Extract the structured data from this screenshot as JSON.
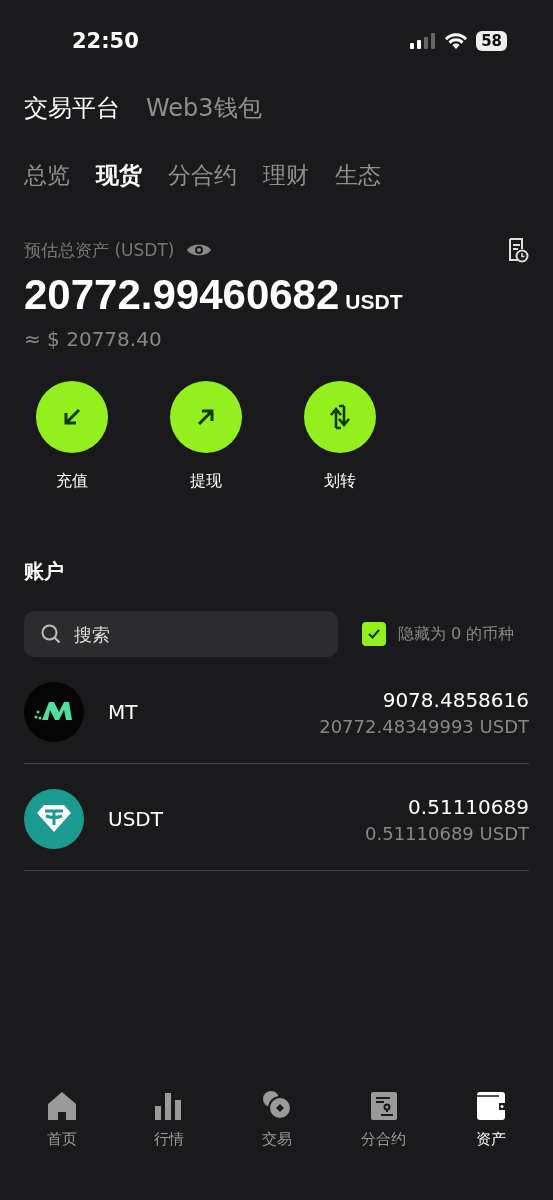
{
  "status_bar": {
    "time": "22:50",
    "battery": "58"
  },
  "top_tabs": [
    {
      "label": "交易平台",
      "selected": true
    },
    {
      "label": "Web3钱包",
      "selected": false
    }
  ],
  "sub_tabs": [
    {
      "label": "总览",
      "selected": false
    },
    {
      "label": "现货",
      "selected": true
    },
    {
      "label": "分合约",
      "selected": false
    },
    {
      "label": "理财",
      "selected": false
    },
    {
      "label": "生态",
      "selected": false
    }
  ],
  "balance": {
    "label": "预估总资产 (USDT)",
    "amount": "20772.99460682",
    "unit": "USDT",
    "fiat": "≈ $ 20778.40"
  },
  "actions": [
    {
      "kind": "deposit",
      "label": "充值"
    },
    {
      "kind": "withdraw",
      "label": "提现"
    },
    {
      "kind": "transfer",
      "label": "划转"
    }
  ],
  "accounts": {
    "title": "账户",
    "search": {
      "placeholder": "搜索"
    },
    "hide_zero": {
      "label": "隐藏为 0 的币种",
      "checked": true
    },
    "rows": [
      {
        "kind": "mt",
        "symbol": "MT",
        "amount": "9078.4858616",
        "value": "20772.48349993 USDT"
      },
      {
        "kind": "usdt",
        "symbol": "USDT",
        "amount": "0.51110689",
        "value": "0.51110689 USDT"
      }
    ]
  },
  "bottom_nav": [
    {
      "kind": "home",
      "label": "首页",
      "selected": false
    },
    {
      "kind": "chart",
      "label": "行情",
      "selected": false
    },
    {
      "kind": "coins",
      "label": "交易",
      "selected": false
    },
    {
      "kind": "contract",
      "label": "分合约",
      "selected": false
    },
    {
      "kind": "wallet",
      "label": "资产",
      "selected": true
    }
  ]
}
